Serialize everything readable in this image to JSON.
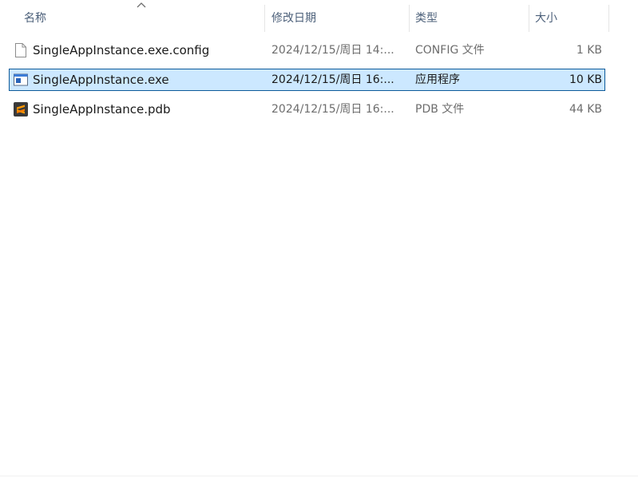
{
  "columns": {
    "name": "名称",
    "date": "修改日期",
    "type": "类型",
    "size": "大小"
  },
  "sort": {
    "column": "name",
    "direction": "ascending",
    "icon": "sort-up-arrow-icon"
  },
  "files": [
    {
      "name": "SingleAppInstance.exe.config",
      "date": "2024/12/15/周日 14:...",
      "type": "CONFIG 文件",
      "size": "1 KB",
      "icon": "blank-document-icon",
      "selected": false
    },
    {
      "name": "SingleAppInstance.exe",
      "date": "2024/12/15/周日 16:...",
      "type": "应用程序",
      "size": "10 KB",
      "icon": "application-window-icon",
      "selected": true
    },
    {
      "name": "SingleAppInstance.pdb",
      "date": "2024/12/15/周日 16:...",
      "type": "PDB 文件",
      "size": "44 KB",
      "icon": "sublime-text-icon",
      "selected": false
    }
  ],
  "colors": {
    "selection_bg": "#cce8ff",
    "selection_border": "#0c5a9a",
    "header_text": "#4c607a",
    "secondary_text": "#6d6d6d"
  }
}
